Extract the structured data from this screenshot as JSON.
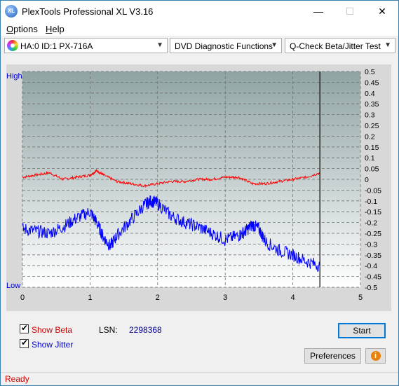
{
  "window": {
    "title": "PlexTools Professional XL V3.16",
    "icon_label": "XL",
    "minimize_glyph": "—",
    "maximize_glyph": "☐",
    "close_glyph": "✕"
  },
  "menu": {
    "items": [
      {
        "label": "Options",
        "mnemonic": "O"
      },
      {
        "label": "Help",
        "mnemonic": "H"
      }
    ]
  },
  "toolbar": {
    "drive": "HA:0 ID:1  PX-716A",
    "function": "DVD Diagnostic Functions",
    "test": "Q-Check Beta/Jitter Test"
  },
  "chart_labels": {
    "high": "High",
    "low": "Low"
  },
  "chart_data": {
    "type": "line",
    "xlim": [
      0,
      5
    ],
    "x_ticks": [
      "0",
      "1",
      "2",
      "3",
      "4",
      "5"
    ],
    "ylim": [
      -0.5,
      0.5
    ],
    "right_ticks": [
      "0.5",
      "0.45",
      "0.4",
      "0.35",
      "0.3",
      "0.25",
      "0.2",
      "0.15",
      "0.1",
      "0.05",
      "0",
      "-0.05",
      "-0.1",
      "-0.15",
      "-0.2",
      "-0.25",
      "-0.3",
      "-0.35",
      "-0.4",
      "-0.45",
      "-0.5"
    ],
    "end_marker_x": 4.4,
    "grid": true,
    "series": [
      {
        "name": "Beta",
        "color": "#ff0000",
        "x": [
          0,
          0.2,
          0.4,
          0.6,
          0.8,
          1.0,
          1.1,
          1.2,
          1.4,
          1.6,
          1.8,
          2.0,
          2.2,
          2.4,
          2.6,
          2.8,
          3.0,
          3.2,
          3.4,
          3.6,
          3.8,
          4.0,
          4.2,
          4.4
        ],
        "y": [
          0.01,
          0.02,
          0.03,
          0.0,
          0.01,
          0.02,
          0.04,
          0.02,
          -0.01,
          -0.02,
          -0.03,
          -0.02,
          -0.01,
          -0.01,
          0.0,
          0.0,
          0.01,
          0.01,
          -0.02,
          -0.02,
          -0.01,
          0.0,
          0.01,
          0.03
        ]
      },
      {
        "name": "Jitter",
        "color": "#0000ff",
        "x": [
          0,
          0.2,
          0.4,
          0.6,
          0.8,
          1.0,
          1.1,
          1.2,
          1.3,
          1.4,
          1.6,
          1.8,
          1.9,
          2.0,
          2.2,
          2.4,
          2.6,
          2.8,
          3.0,
          3.2,
          3.3,
          3.4,
          3.5,
          3.6,
          3.8,
          4.0,
          4.2,
          4.4
        ],
        "y": [
          -0.23,
          -0.24,
          -0.25,
          -0.22,
          -0.18,
          -0.15,
          -0.2,
          -0.27,
          -0.31,
          -0.26,
          -0.19,
          -0.12,
          -0.1,
          -0.11,
          -0.17,
          -0.2,
          -0.22,
          -0.25,
          -0.28,
          -0.26,
          -0.24,
          -0.21,
          -0.23,
          -0.29,
          -0.33,
          -0.35,
          -0.38,
          -0.4
        ]
      }
    ]
  },
  "controls": {
    "show_beta": {
      "label": "Show Beta",
      "checked": true,
      "color": "#cc0000"
    },
    "show_jitter": {
      "label": "Show Jitter",
      "checked": true,
      "color": "#0000cc"
    },
    "lsn_label": "LSN:",
    "lsn_value": "2298368",
    "start": "Start",
    "preferences": "Preferences",
    "info_glyph": "i"
  },
  "status": {
    "text": "Ready",
    "color": "#cc0000"
  }
}
